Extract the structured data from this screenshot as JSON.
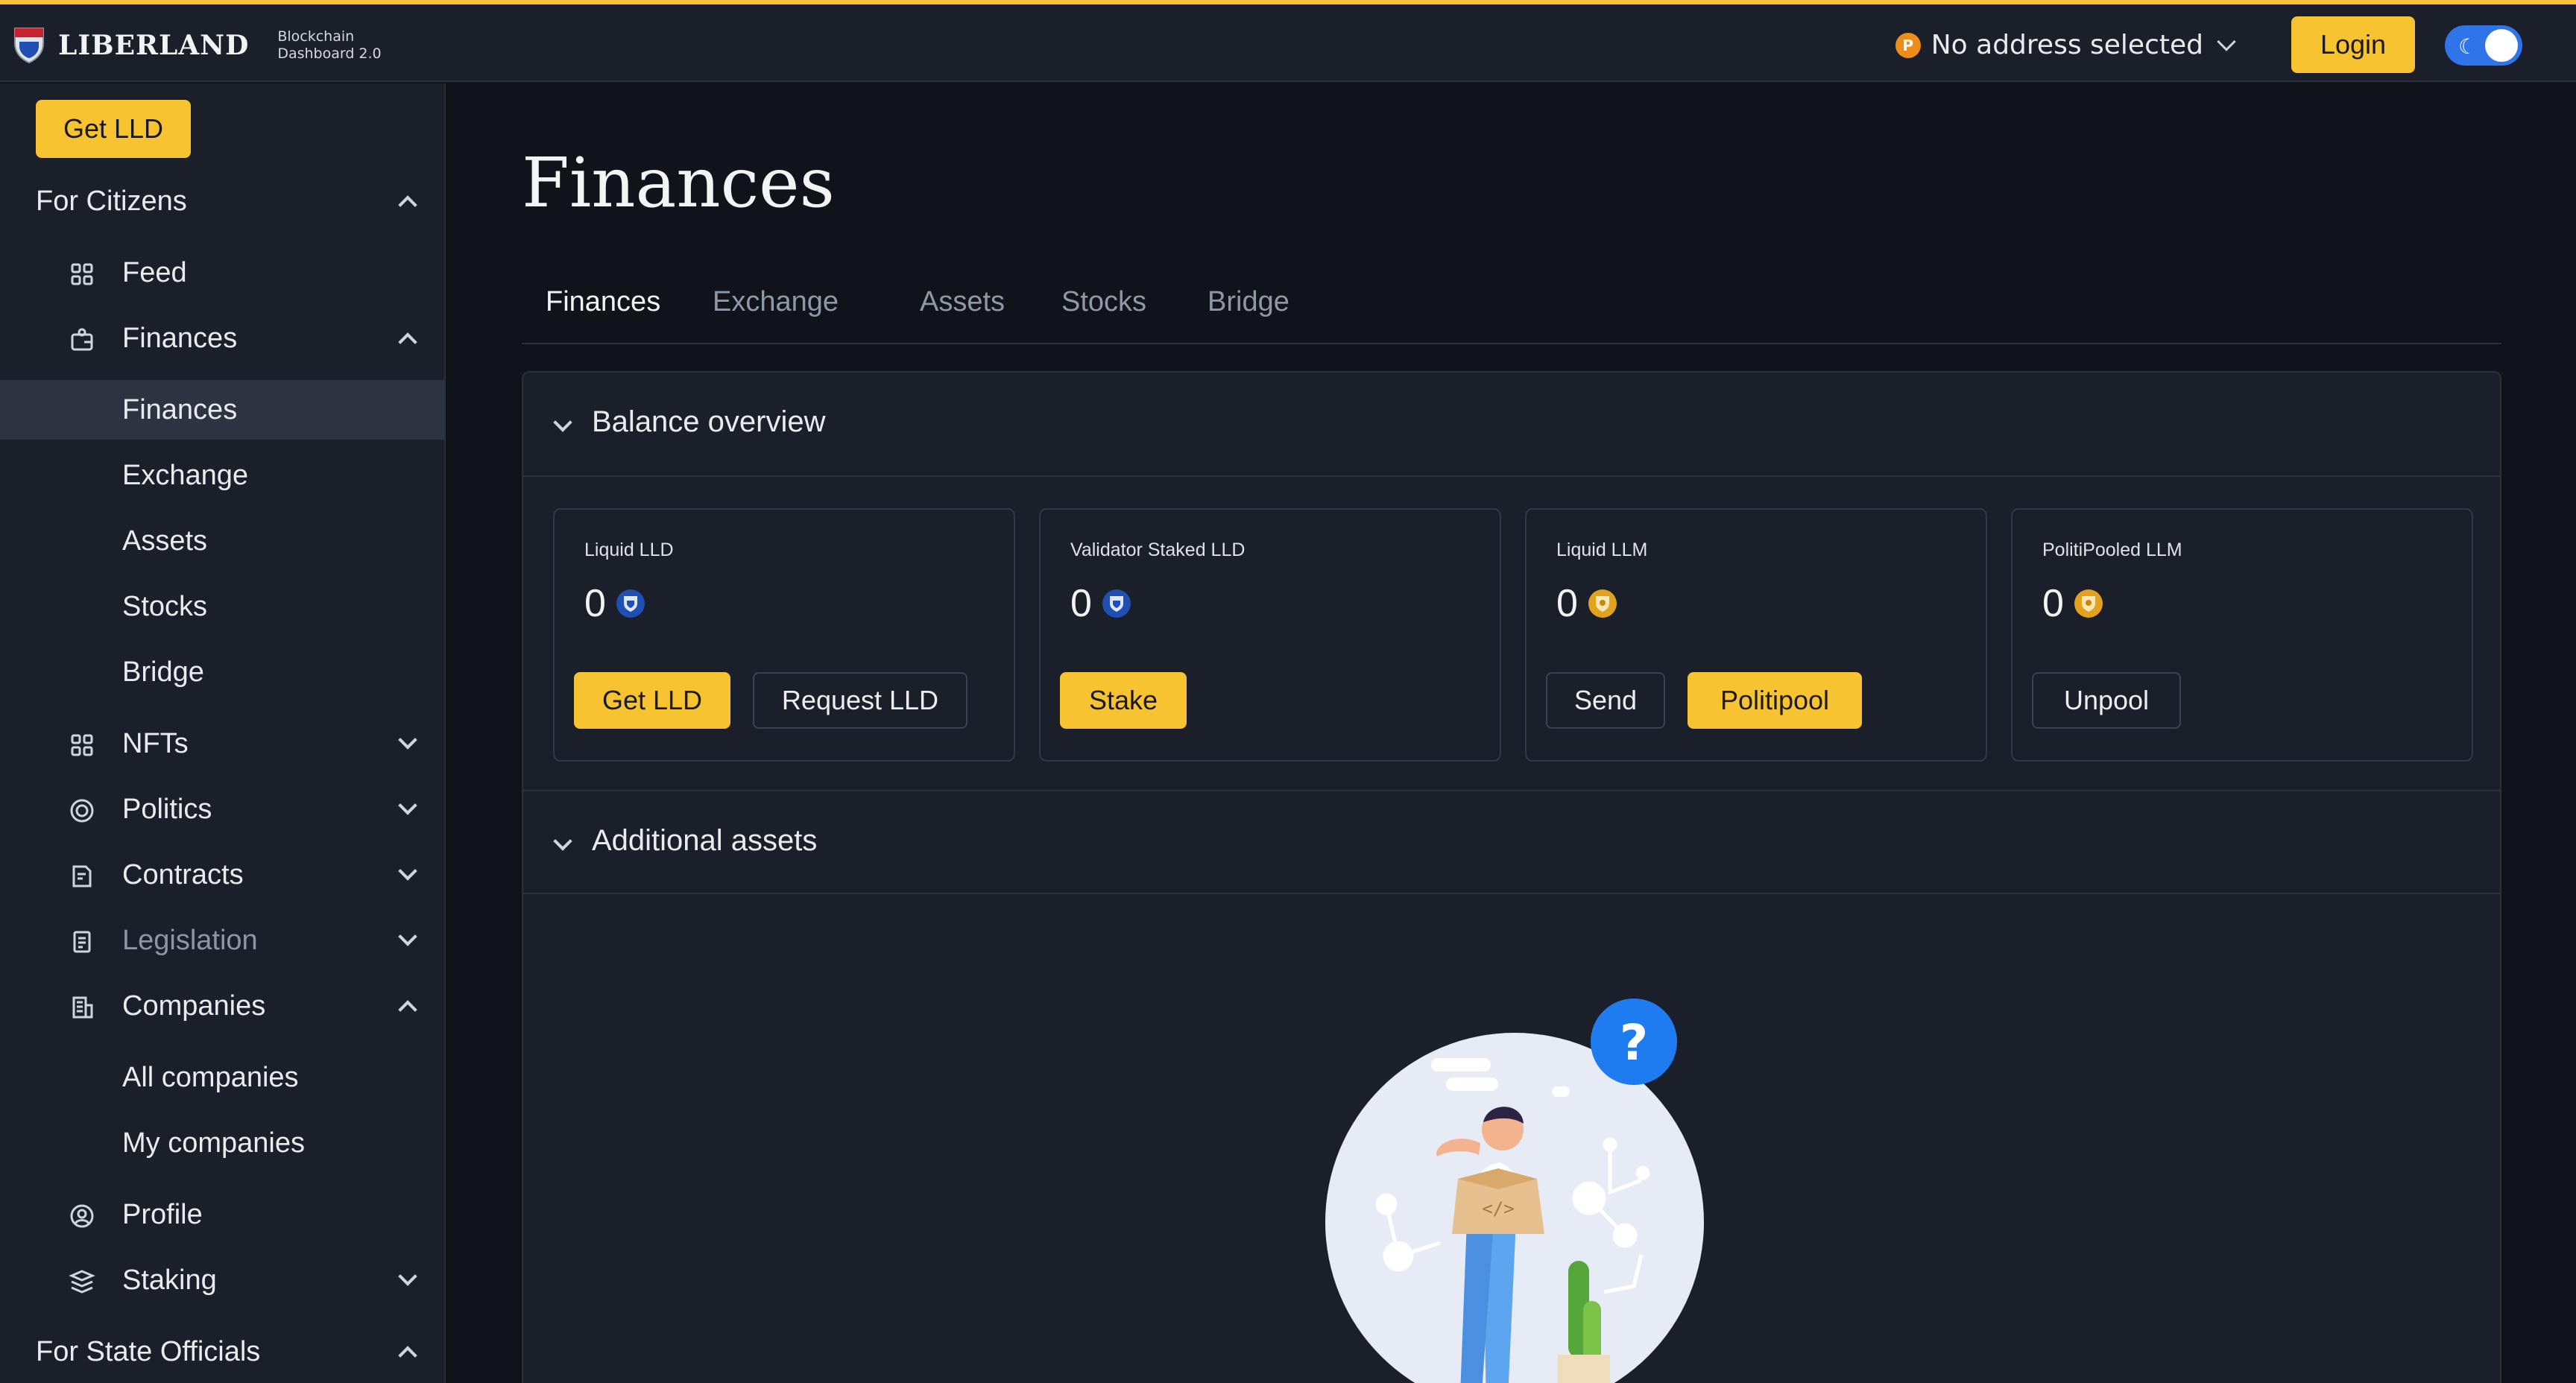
{
  "header": {
    "brand": "LIBERLAND",
    "brand_sub_1": "Blockchain",
    "brand_sub_2": "Dashboard 2.0",
    "address_label": "No address selected",
    "login_label": "Login",
    "accent_color": "#f7c331"
  },
  "sidebar": {
    "get_lld_label": "Get LLD",
    "sections": {
      "citizens": "For Citizens",
      "officials": "For State Officials"
    },
    "items": {
      "feed": "Feed",
      "finances": "Finances",
      "finances_sub": [
        "Finances",
        "Exchange",
        "Assets",
        "Stocks",
        "Bridge"
      ],
      "nfts": "NFTs",
      "politics": "Politics",
      "contracts": "Contracts",
      "legislation": "Legislation",
      "companies": "Companies",
      "companies_sub": [
        "All companies",
        "My companies"
      ],
      "profile": "Profile",
      "staking": "Staking"
    }
  },
  "main": {
    "title": "Finances",
    "tabs": [
      "Finances",
      "Exchange",
      "Assets",
      "Stocks",
      "Bridge"
    ],
    "balance_section": "Balance overview",
    "additional_section": "Additional assets",
    "cards": [
      {
        "label": "Liquid LLD",
        "value": "0",
        "token": "lld",
        "buttons": [
          "Get LLD",
          "Request LLD"
        ]
      },
      {
        "label": "Validator Staked LLD",
        "value": "0",
        "token": "lld",
        "buttons": [
          "Stake"
        ]
      },
      {
        "label": "Liquid LLM",
        "value": "0",
        "token": "llm",
        "buttons": [
          "Send",
          "Politipool"
        ]
      },
      {
        "label": "PolitiPooled LLM",
        "value": "0",
        "token": "llm",
        "buttons": [
          "Unpool"
        ]
      }
    ],
    "illustration_mark": "?"
  }
}
